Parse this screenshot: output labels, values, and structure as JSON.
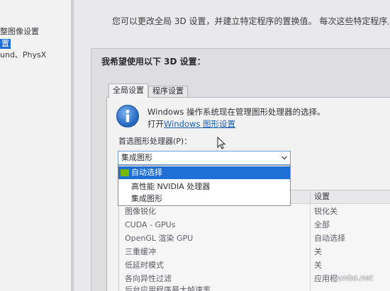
{
  "sidebar": {
    "items": [
      {
        "label": "整图像设置"
      },
      {
        "label": "置"
      },
      {
        "label": "und、PhysX"
      }
    ]
  },
  "description": "您可以更改全局 3D 设置，并建立特定程序的置换值。 每次这些特定程序启",
  "panel": {
    "title": "我希望使用以下 3D 设置："
  },
  "tabs": [
    {
      "label": "全局设置",
      "selected": true
    },
    {
      "label": "程序设置",
      "selected": false
    }
  ],
  "info": {
    "icon": "info-icon",
    "message": "Windows 操作系统现在管理图形处理器的选择。",
    "link_prefix": "打开",
    "link_text": "Windows 图形设置"
  },
  "preferred_gpu": {
    "label": "首选图形处理器(P)：",
    "selected": "集成图形",
    "options": [
      "自动选择",
      "高性能 NVIDIA 处理器",
      "集成图形"
    ],
    "highlighted_index": 0,
    "highlighted_icon": "nvidia-icon"
  },
  "settings_table": {
    "header_setting": "设置",
    "rows": [
      {
        "feature": "图像锐化",
        "setting": "锐化关"
      },
      {
        "feature": "CUDA - GPUs",
        "setting": "全部"
      },
      {
        "feature": "OpenGL 渲染 GPU",
        "setting": "自动选择"
      },
      {
        "feature": "三重缓冲",
        "setting": "关"
      },
      {
        "feature": "低延时模式",
        "setting": "关"
      },
      {
        "feature": "各向异性过滤",
        "setting": "应用程"
      },
      {
        "feature": "后台应用程序最大帧速率",
        "setting": ""
      }
    ]
  },
  "watermark": {
    "text": "yunbo.net"
  },
  "colors": {
    "highlight": "#1e6fd6",
    "link": "#1a5fb4",
    "info": "#2a6fc6",
    "nvidia": "#76b900"
  }
}
